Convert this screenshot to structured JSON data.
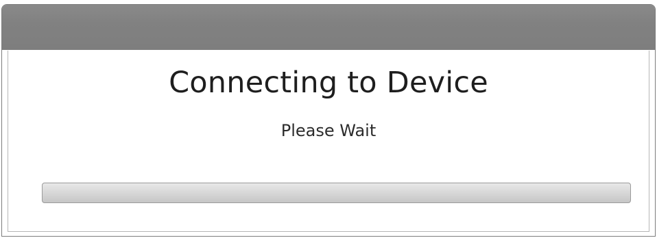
{
  "dialog": {
    "title": "",
    "heading": "Connecting to Device",
    "message": "Please Wait"
  },
  "progress": {
    "fraction": 0
  },
  "colors": {
    "title_bar": "#818181",
    "background": "#ffffff",
    "progress_track": "#d3d3d3"
  }
}
